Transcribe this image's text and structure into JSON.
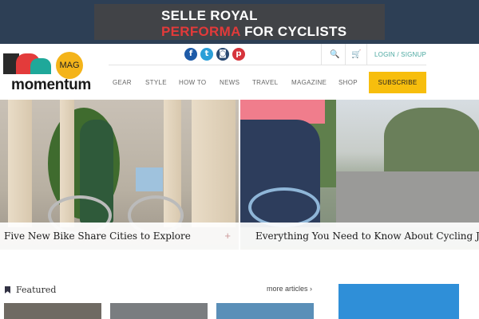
{
  "ad": {
    "line1": "SELLE ROYAL",
    "line2_red": "PERFORMA",
    "line2_white": " FOR CYCLISTS"
  },
  "logo": {
    "badge": "MAG",
    "wordmark": "momentum"
  },
  "social": {
    "facebook": "f",
    "twitter": "t",
    "instagram": "◙",
    "pinterest": "p"
  },
  "utility": {
    "search_icon": "🔍",
    "cart_icon": "🛒",
    "login": "LOGIN / SIGNUP"
  },
  "nav": {
    "items": [
      "GEAR",
      "STYLE",
      "HOW TO",
      "NEWS",
      "TRAVEL",
      "MAGAZINE",
      "SHOP"
    ],
    "subscribe": "SUBSCRIBE"
  },
  "hero": {
    "left_caption": "Five New Bike Share Cities to Explore",
    "right_caption": "Everything You Need to Know About Cycling Jeans",
    "plus": "+"
  },
  "featured": {
    "title": "Featured",
    "more": "more articles ›"
  },
  "colors": {
    "accent": "#f7be0d",
    "link": "#4aa8a0",
    "header_bg": "#2d3f55"
  }
}
